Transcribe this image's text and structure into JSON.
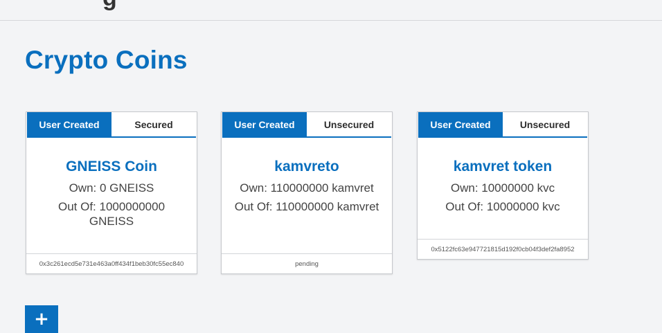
{
  "header": {
    "title_fragment": "g"
  },
  "page": {
    "title": "Crypto Coins",
    "add_button_label": "+"
  },
  "coins": [
    {
      "tab_left": "User Created",
      "tab_right": "Secured",
      "name": "GNEISS Coin",
      "own": "Own: 0 GNEISS",
      "out_of": "Out Of: 1000000000 GNEISS",
      "footer": "0x3c261ecd5e731e463a0ff434f1beb30fc55ec840"
    },
    {
      "tab_left": "User Created",
      "tab_right": "Unsecured",
      "name": "kamvreto",
      "own": "Own: 110000000 kamvret",
      "out_of": "Out Of: 110000000 kamvret",
      "footer": "pending"
    },
    {
      "tab_left": "User Created",
      "tab_right": "Unsecured",
      "name": "kamvret token",
      "own": "Own: 10000000 kvc",
      "out_of": "Out Of: 10000000 kvc",
      "footer": "0x5122fc63e947721815d192f0cb04f3def2fa8952"
    }
  ],
  "colors": {
    "accent": "#0a6fbe",
    "background": "#f3f4f6",
    "card": "#ffffff"
  }
}
